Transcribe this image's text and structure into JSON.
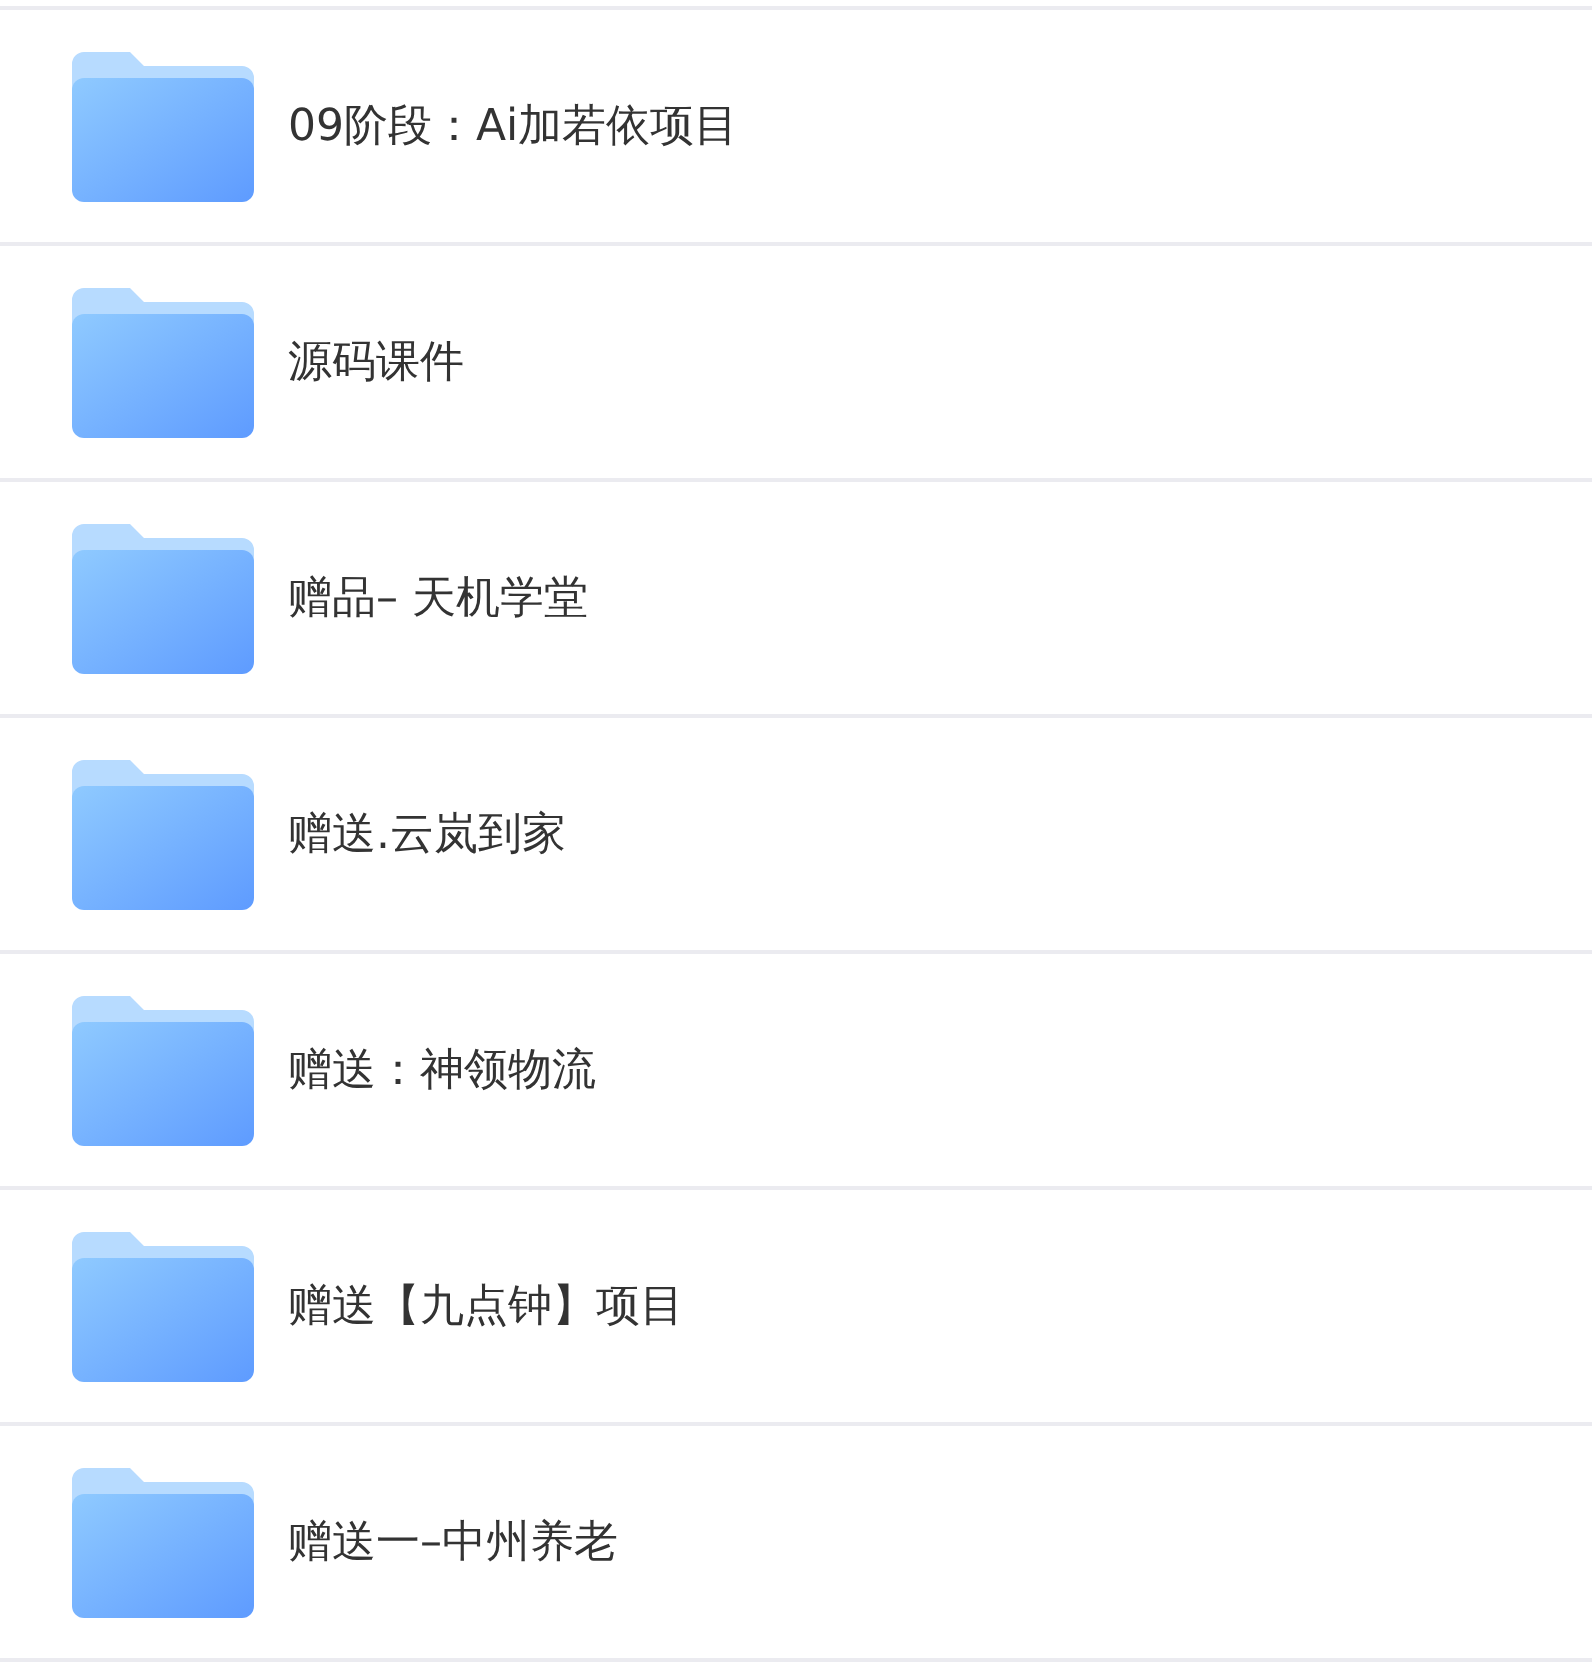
{
  "folders": [
    {
      "name": "09阶段：Ai加若依项目"
    },
    {
      "name": "源码课件"
    },
    {
      "name": "赠品– 天机学堂"
    },
    {
      "name": "赠送.云岚到家"
    },
    {
      "name": "赠送：神领物流"
    },
    {
      "name": "赠送【九点钟】项目"
    },
    {
      "name": "赠送一–中州养老"
    }
  ]
}
